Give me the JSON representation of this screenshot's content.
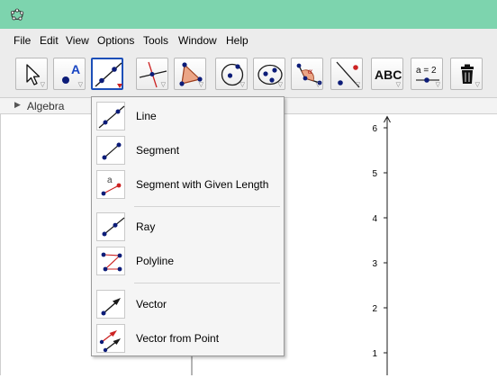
{
  "menu": [
    "File",
    "Edit",
    "View",
    "Options",
    "Tools",
    "Window",
    "Help"
  ],
  "toolbar": {
    "text_tool_label": "ABC",
    "slider_tool_label": "a = 2"
  },
  "algebra_view": {
    "title": "Algebra"
  },
  "line_tools": {
    "items": [
      {
        "label": "Line",
        "icon": "line-icon"
      },
      {
        "label": "Segment",
        "icon": "segment-icon"
      },
      {
        "label": "Segment with Given Length",
        "icon": "segment-given-length-icon",
        "icon_text": "a"
      },
      {
        "label": "Ray",
        "icon": "ray-icon"
      },
      {
        "label": "Polyline",
        "icon": "polyline-icon"
      },
      {
        "label": "Vector",
        "icon": "vector-icon"
      },
      {
        "label": "Vector from Point",
        "icon": "vector-from-point-icon"
      }
    ]
  },
  "graphics_view": {
    "y_axis_ticks": [
      "6",
      "5",
      "4",
      "3",
      "2",
      "1"
    ]
  },
  "colors": {
    "title_bar": "#7dd4ae",
    "selected_tool_border": "#1c4fb8",
    "point_blue": "#0c1c78",
    "accent_red": "#cc2222"
  }
}
